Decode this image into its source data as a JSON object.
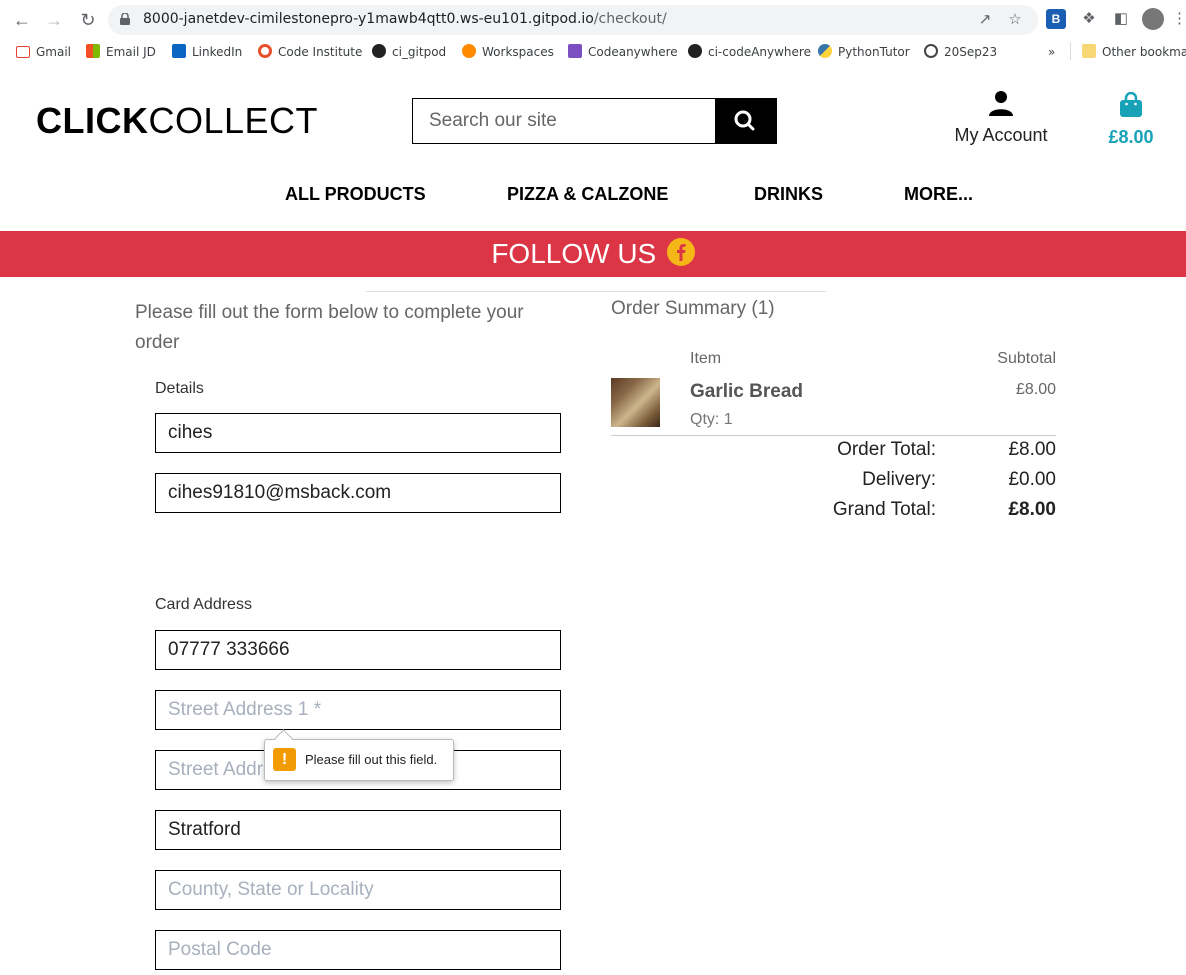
{
  "browser": {
    "url_host": "8000-janetdev-cimilestonepro-y1mawb4qtt0.ws-eu101.gitpod.io",
    "url_path": "/checkout/",
    "bookmarks": [
      "Gmail",
      "Email JD",
      "LinkedIn",
      "Code Institute",
      "ci_gitpod",
      "Workspaces",
      "Codeanywhere",
      "ci-codeAnywhere",
      "PythonTutor",
      "20Sep23"
    ],
    "more_bookmarks": "»",
    "other_bookmarks": "Other bookmar"
  },
  "header": {
    "logo_bold": "CLICK",
    "logo_light": "COLLECT",
    "search_placeholder": "Search our site",
    "account_label": "My Account",
    "cart_total": "£8.00"
  },
  "nav": {
    "items": [
      "ALL PRODUCTS",
      "PIZZA & CALZONE",
      "DRINKS",
      "MORE..."
    ]
  },
  "banner": {
    "text": "FOLLOW US"
  },
  "form": {
    "intro": "Please fill out the form below to complete your order",
    "details_label": "Details",
    "full_name_value": "cihes",
    "email_value": "cihes91810@msback.com",
    "card_address_label": "Card Address",
    "phone_value": "07777 333666",
    "street1_placeholder": "Street Address 1 *",
    "street2_placeholder": "Street Address 2",
    "town_value": "Stratford",
    "county_placeholder": "County, State or Locality",
    "postcode_placeholder": "Postal Code",
    "validation_message": "Please fill out this field."
  },
  "summary": {
    "title": "Order Summary (1)",
    "col_item": "Item",
    "col_subtotal": "Subtotal",
    "product_name": "Garlic Bread",
    "product_qty": "Qty: 1",
    "product_subtotal": "£8.00",
    "order_total_label": "Order Total:",
    "order_total": "£8.00",
    "delivery_label": "Delivery:",
    "delivery": "£0.00",
    "grand_total_label": "Grand Total:",
    "grand_total": "£8.00"
  },
  "colors": {
    "banner_red": "#dc3545",
    "cart_teal": "#17a2b8",
    "warning_orange": "#f29b05",
    "facebook_yellow": "#f5b718"
  }
}
